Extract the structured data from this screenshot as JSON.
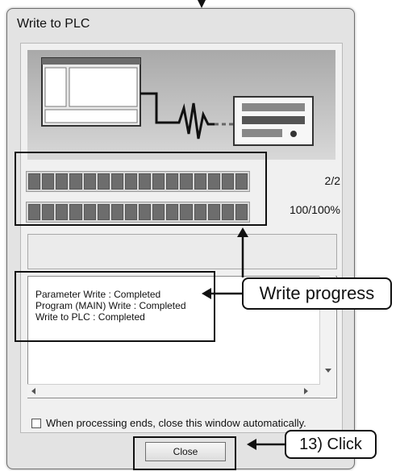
{
  "window": {
    "title": "Write to PLC"
  },
  "progress": {
    "overall_text": "2/2",
    "overall_fraction": 1.0,
    "current_text": "100/100%",
    "current_fraction": 1.0
  },
  "log": {
    "lines": [
      "Parameter Write : Completed",
      "Program (MAIN) Write : Completed",
      "Write to PLC : Completed"
    ]
  },
  "options": {
    "auto_close_label": "When processing ends, close this window automatically.",
    "auto_close_checked": false
  },
  "buttons": {
    "close_label": "Close"
  },
  "annotations": {
    "write_progress": "Write progress",
    "click_step": "13) Click"
  },
  "icons": [
    "computer-screen-icon",
    "signal-wave-icon",
    "plc-device-icon",
    "scroll-left-icon",
    "scroll-right-icon",
    "scroll-down-icon"
  ]
}
